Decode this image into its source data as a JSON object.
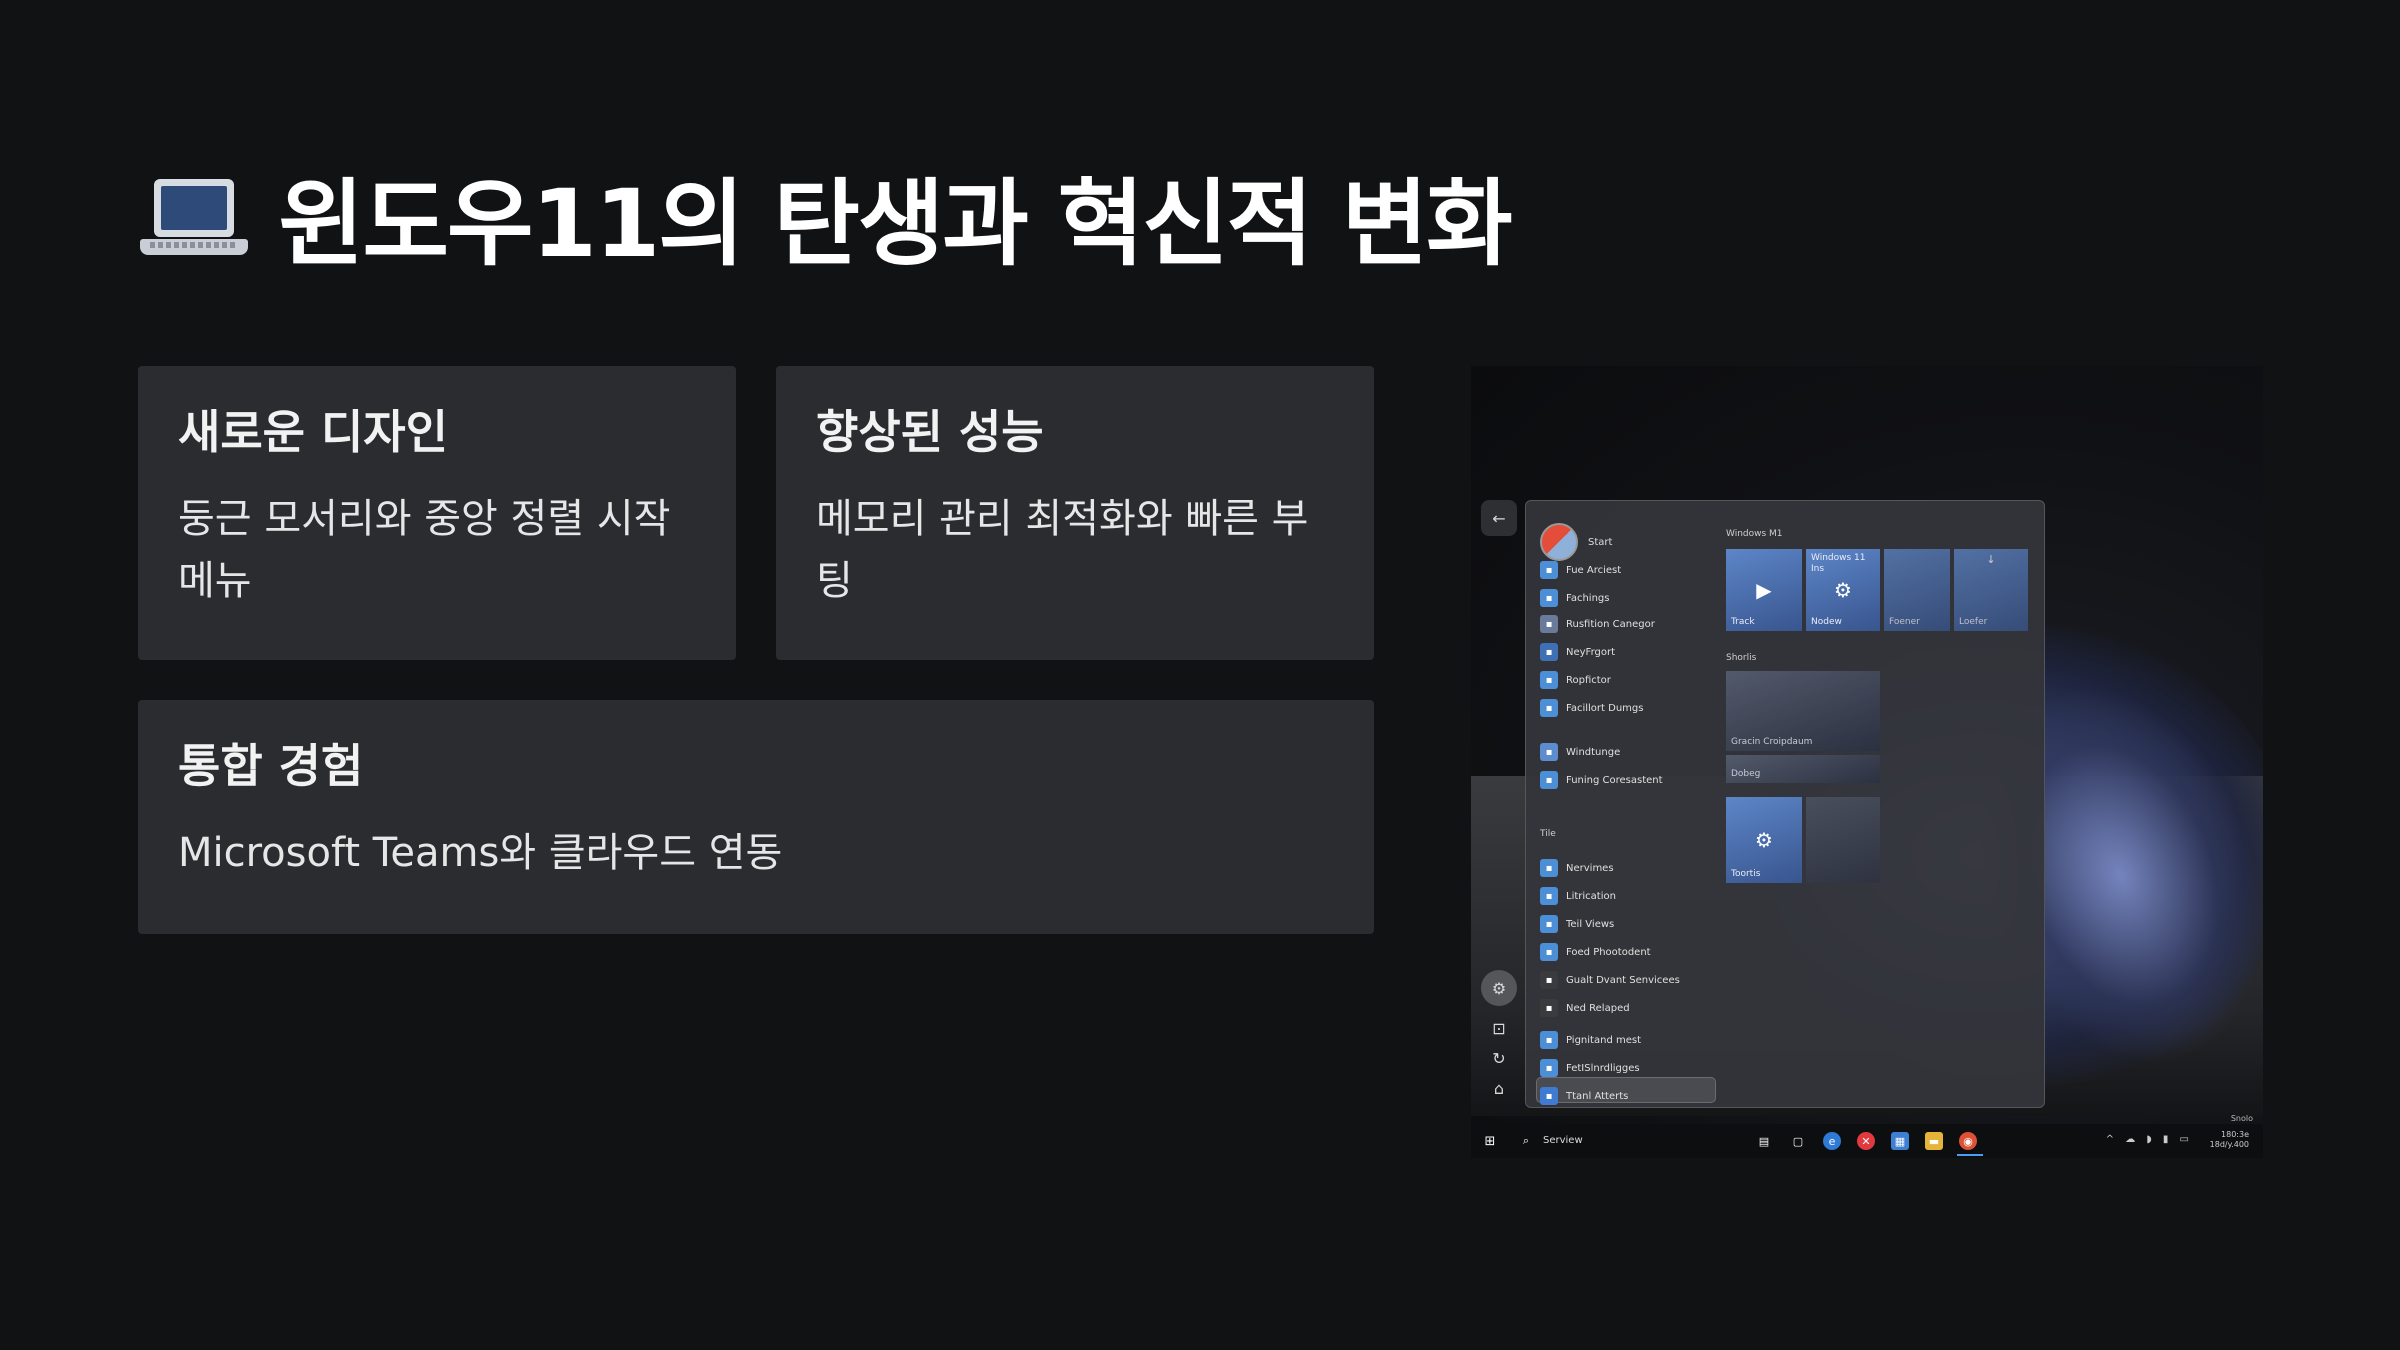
{
  "page": {
    "title": "윈도우11의 탄생과 혁신적 변화",
    "title_icon": "laptop-icon"
  },
  "cards": [
    {
      "title": "새로운 디자인",
      "desc": "둥근 모서리와 중앙 정렬 시작 메뉴"
    },
    {
      "title": "향상된 성능",
      "desc": "메모리 관리 최적화와 빠른 부팅"
    },
    {
      "title": "통합 경험",
      "desc": "Microsoft Teams와 클라우드 연동"
    }
  ],
  "screenshot": {
    "start_label": "Start",
    "apps": [
      "Fue Arciest",
      "Fachings",
      "Rusfition Canegor",
      "NeyFrgort",
      "Ropfictor",
      "Facillort Dumgs",
      "Windtunge",
      "Funing Coresastent",
      "Nervimes",
      "Litrication",
      "Teil Views",
      "Foed Phootodent",
      "Gualt Dvant Senvicees",
      "Ned Relaped",
      "Pignitand mest",
      "FetISlnrdligges",
      "Ttanl Atterts"
    ],
    "section_tile": "Tile",
    "pinned_header": "Windows M1",
    "shortcuts_header": "Shorlis",
    "tiles": [
      {
        "label": "Track",
        "top": ""
      },
      {
        "label": "Nodew",
        "top": "Windows 11 Ins"
      },
      {
        "label": "Foener",
        "top": ""
      },
      {
        "label": "Loefer",
        "top": ""
      },
      {
        "label": "Gracin Croipdaum",
        "top": ""
      },
      {
        "label": "Dobeg",
        "top": ""
      },
      {
        "label": "Toortis",
        "top": ""
      }
    ],
    "taskbar_search": "Serview",
    "tray_time": "180:3e",
    "tray_date": "18d/y.400",
    "tray_label": "Snolo"
  }
}
